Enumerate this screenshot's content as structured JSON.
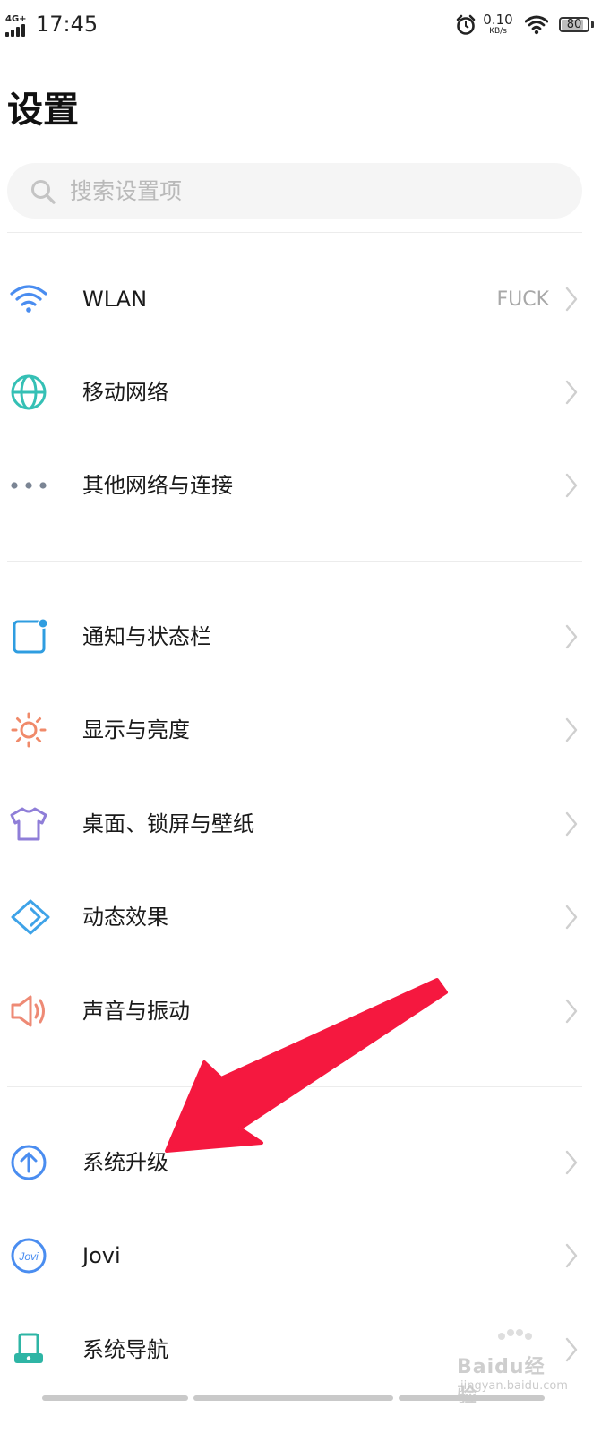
{
  "status_bar": {
    "network": "4G+",
    "time": "17:45",
    "alarm_icon": "alarm-clock-icon",
    "speed_value": "0.10",
    "speed_unit": "KB/s",
    "wifi_icon": "wifi-icon",
    "battery": "80",
    "battery_level": 0.8
  },
  "header": {
    "title": "设置"
  },
  "search": {
    "placeholder": "搜索设置项",
    "value": ""
  },
  "sections": [
    {
      "items": [
        {
          "label": "WLAN",
          "value": "FUCK",
          "icon": "wifi-icon",
          "color": "#4a8df0"
        },
        {
          "label": "移动网络",
          "icon": "globe-icon",
          "color": "#35c0b5"
        },
        {
          "label": "其他网络与连接",
          "icon": "more-dots-icon",
          "color": "#7b8594"
        }
      ]
    },
    {
      "items": [
        {
          "label": "通知与状态栏",
          "icon": "notification-icon",
          "color": "#2f9de0"
        },
        {
          "label": "显示与亮度",
          "icon": "sun-icon",
          "color": "#f08a6a"
        },
        {
          "label": "桌面、锁屏与壁纸",
          "icon": "tshirt-icon",
          "color": "#8f7ed8"
        },
        {
          "label": "动态效果",
          "icon": "diamond-icon",
          "color": "#3fa3e8"
        },
        {
          "label": "声音与振动",
          "icon": "speaker-icon",
          "color": "#ee8a75"
        }
      ]
    },
    {
      "items": [
        {
          "label": "系统升级",
          "icon": "upgrade-arrow-icon",
          "color": "#4a8df0"
        },
        {
          "label": "Jovi",
          "icon": "jovi-icon",
          "color": "#4a8df0"
        },
        {
          "label": "系统导航",
          "icon": "navigation-icon",
          "color": "#2eb5a5"
        }
      ]
    }
  ],
  "annotation": {
    "color": "#f5183f",
    "icon": "red-arrow-annotation"
  },
  "watermark": {
    "text": "Baidu经验",
    "url": "jingyan.baidu.com"
  }
}
